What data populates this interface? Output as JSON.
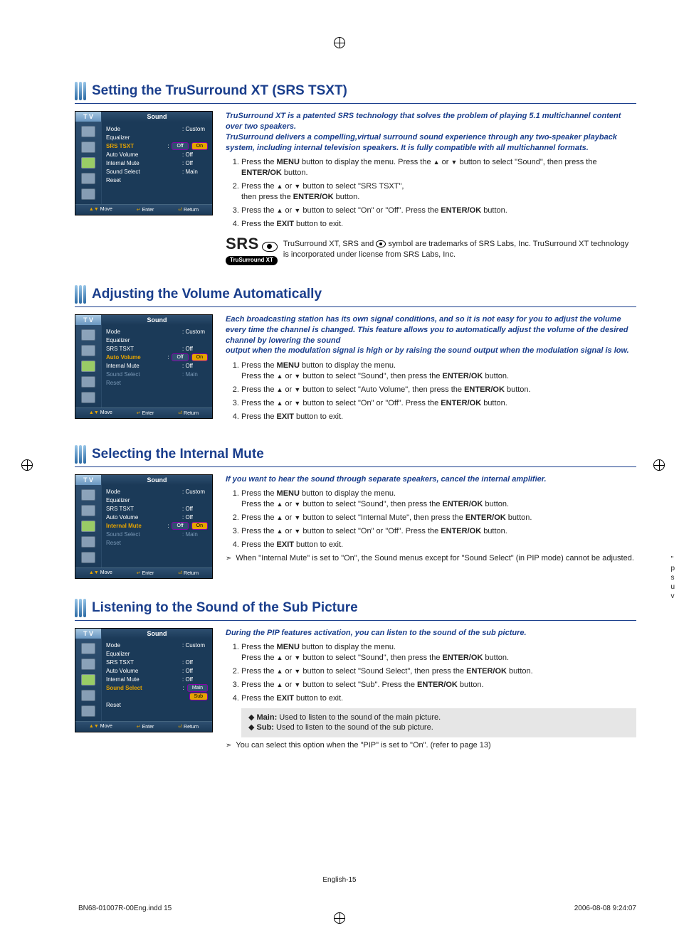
{
  "arrows": {
    "up": "▲",
    "down": "▼"
  },
  "osd_common": {
    "tv": "T V",
    "title": "Sound",
    "rows": {
      "mode": "Mode",
      "equalizer": "Equalizer",
      "srs": "SRS TSXT",
      "auto": "Auto Volume",
      "mute": "Internal Mute",
      "select": "Sound Select",
      "reset": "Reset"
    },
    "vals": {
      "custom": ": Custom",
      "off": ": Off",
      "main": ": Main"
    },
    "btn": {
      "on": "On",
      "off": "Off",
      "main": "Main",
      "sub": "Sub"
    },
    "foot": {
      "move": "Move",
      "enter": "Enter",
      "return": "Return",
      "moveKey": "▲▼",
      "enterKey": "↵",
      "returnKey": "⏎"
    }
  },
  "sections": [
    {
      "title": "Setting the TruSurround XT (SRS TSXT)",
      "intro": "TruSurround XT is a patented SRS technology that solves the problem of playing 5.1 multichannel content over two speakers.\nTruSurround delivers a compelling,virtual surround sound experience through any two-speaker playback system, including internal television speakers. It is fully compatible with all multichannel formats.",
      "osd": {
        "highlight": "srs",
        "srs_opts": true
      },
      "steps": [
        "Press the <b>MENU</b> button to display the menu. Press the <span class='arrow'>▲</span> or <span class='arrow'>▼</span> button to select \"Sound\", then press the <b>ENTER/OK</b> button.",
        "Press the <span class='arrow'>▲</span> or <span class='arrow'>▼</span> button to select \"SRS TSXT\",<br>then press the <b>ENTER/OK</b> button.",
        "Press the <span class='arrow'>▲</span> or <span class='arrow'>▼</span> button to select \"On\" or \"Off\". Press the <b>ENTER/OK</b> button.",
        "Press the <b>EXIT</b> button to exit."
      ],
      "srs_note": "TruSurround XT, SRS and <span class='small-eye'><span class='outer'><span class='inner'></span></span></span> symbol are trademarks of SRS Labs, Inc. TruSurround XT technology is incorporated under license from SRS Labs, Inc.",
      "srs_logo_text": "SRS",
      "srs_pill": "TruSurround XT"
    },
    {
      "title": "Adjusting the Volume Automatically",
      "intro": "Each broadcasting station has its own signal conditions, and so it is not easy for you to adjust the volume every time the channel is changed. This feature allows you to automatically adjust the volume of the desired channel by lowering the sound\noutput when the modulation signal is high or by raising the sound output when the modulation signal is low.",
      "osd": {
        "highlight": "auto",
        "auto_opts": true,
        "dim_select": true
      },
      "steps": [
        "Press the <b>MENU</b> button to display the menu.<br>Press the <span class='arrow'>▲</span> or <span class='arrow'>▼</span> button to select \"Sound\", then press the <b>ENTER/OK</b> button.",
        "Press the <span class='arrow'>▲</span> or <span class='arrow'>▼</span> button to select \"Auto Volume\", then press the <b>ENTER/OK</b> button.",
        "Press the <span class='arrow'>▲</span> or <span class='arrow'>▼</span> button to select \"On\" or \"Off\". Press the <b>ENTER/OK</b> button.",
        "Press the <b>EXIT</b> button to exit."
      ]
    },
    {
      "title": "Selecting the Internal Mute",
      "intro": "If you want to hear the sound through separate speakers, cancel the internal amplifier.",
      "osd": {
        "highlight": "mute",
        "mute_opts": true,
        "dim_select": true
      },
      "steps": [
        "Press the <b>MENU</b> button to display the menu.<br>Press the <span class='arrow'>▲</span> or <span class='arrow'>▼</span> button to select \"Sound\", then press the <b>ENTER/OK</b> button.",
        "Press the <span class='arrow'>▲</span> or <span class='arrow'>▼</span> button to select \"Internal Mute\", then press the <b>ENTER/OK</b> button.",
        "Press the <span class='arrow'>▲</span> or <span class='arrow'>▼</span> button to select \"On\" or \"Off\". Press the <b>ENTER/OK</b> button.",
        "Press the <b>EXIT</b> button to exit."
      ],
      "after": "When \"Internal Mute\" is set to \"On\", the Sound menus except for \"Sound Select\" (in PIP mode) cannot be adjusted."
    },
    {
      "title": "Listening to the Sound of the Sub Picture",
      "intro": "During the PIP features activation, you can listen to the sound of the sub picture.",
      "osd": {
        "highlight": "select",
        "select_opts": true
      },
      "steps": [
        "Press the <b>MENU</b> button to display the menu.<br>Press the <span class='arrow'>▲</span> or <span class='arrow'>▼</span> button to select \"Sound\", then press the <b>ENTER/OK</b> button.",
        "Press the <span class='arrow'>▲</span> or <span class='arrow'>▼</span> button to select \"Sound Select\", then press the <b>ENTER/OK</b> button.",
        "Press the <span class='arrow'>▲</span> or <span class='arrow'>▼</span> button to select \"Sub\". Press the <b>ENTER/OK</b> button.",
        "Press the <b>EXIT</b> button to exit."
      ],
      "box": [
        "<b>Main:</b> Used to listen to the sound of the main picture.",
        "<b>Sub:</b> Used to listen to the sound of the sub picture."
      ],
      "after": "You can select this option when the \"PIP\" is set to \"On\". (refer to page 13)"
    }
  ],
  "footer": "English-15",
  "print": {
    "left": "BN68-01007R-00Eng.indd   15",
    "right": "2006-08-08     9:24:07"
  },
  "truncated": [
    "\"",
    "p",
    "s",
    "",
    "u",
    "v"
  ]
}
